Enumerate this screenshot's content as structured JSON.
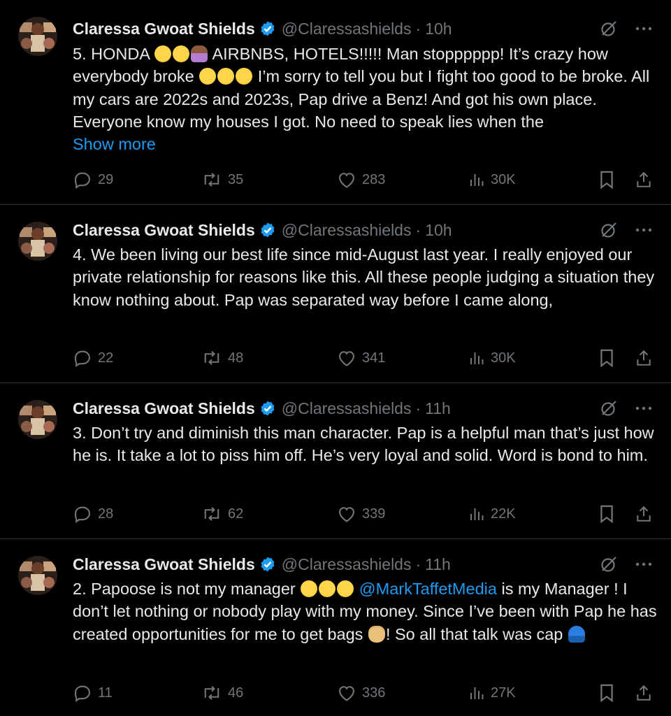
{
  "author": {
    "name": "Claressa Gwoat Shields",
    "handle": "@Claressashields",
    "verified_color": "#1d9bf0"
  },
  "colors": {
    "background": "#000000",
    "text": "#e7e9ea",
    "muted": "#71767b",
    "link": "#1d9bf0",
    "divider": "#2f3336"
  },
  "tweets": [
    {
      "time": "10h",
      "text_parts": [
        "5. HONDA ",
        " AIRBNBS, HOTELS!!!!! Man stopppppp! It’s crazy how everybody broke ",
        " I’m sorry to tell you but I fight too good to be broke. All my cars are 2022s and 2023s, Pap drive a Benz! And got his own place. Everyone know my houses I got. No need to speak lies when the"
      ],
      "show_more": "Show more",
      "replies": "29",
      "reposts": "35",
      "likes": "283",
      "views": "30K"
    },
    {
      "time": "10h",
      "text": "4. We been living our best life since mid-August last year. I really enjoyed our private relationship for reasons like this. All these people judging a situation they know nothing about. Pap was separated way before I came along,",
      "replies": "22",
      "reposts": "48",
      "likes": "341",
      "views": "30K"
    },
    {
      "time": "11h",
      "text": "3. Don’t try and diminish this man character. Pap is a helpful man that’s just how he is. It take a lot to piss him off. He’s very loyal and solid. Word is bond to him.",
      "replies": "28",
      "reposts": "62",
      "likes": "339",
      "views": "22K"
    },
    {
      "time": "11h",
      "text_parts": [
        "2. Papoose is not my manager ",
        " is my Manager ! I don’t let nothing or nobody play with my money. Since I’ve been with Pap he has created opportunities for me to get bags ",
        "! So all that talk was cap"
      ],
      "mention": "@MarkTaffetMedia",
      "replies": "11",
      "reposts": "46",
      "likes": "336",
      "views": "27K"
    }
  ]
}
